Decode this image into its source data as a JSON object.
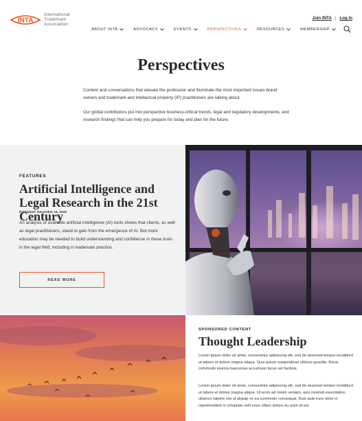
{
  "header": {
    "logo_text": [
      "International",
      "Trademark",
      "Association"
    ],
    "logo_abbr": "INTA",
    "join_link": "Join INTA",
    "separator": "|",
    "login_link": "Log In",
    "nav": [
      {
        "label": "ABOUT INTA",
        "active": false
      },
      {
        "label": "ADVOCACY",
        "active": false
      },
      {
        "label": "EVENTS",
        "active": false
      },
      {
        "label": "PERSPECTIVES",
        "active": true
      },
      {
        "label": "RESOURCES",
        "active": false
      },
      {
        "label": "MEMBERSHIP",
        "active": false
      }
    ],
    "accent_color": "#e8571d"
  },
  "intro": {
    "title": "Perspectives",
    "paragraph1": "Content and conversations that elevate the profession and illuminate the most important issues brand owners and trademark and intellectual property (IP) practitioners are talking about.",
    "paragraph2": "Our global contributors put into perspective business-critical trends, legal and regulatory developments, and research findings that can help you prepare for today and plan for the future."
  },
  "feature": {
    "eyebrow": "FEATURES",
    "title": "Artificial Intelligence and Legal Research in the 21st Century",
    "published": "Published: December 16, 2020",
    "description": "An analysis of available artificial intelligence (AI) tools shows that clients, as well as legal practitioners, stand to gain from the emergence of AI. But more education may be needed to build understanding and confidence in these tools in the legal field, including in trademark practice.",
    "button": "READ MORE"
  },
  "sponsored": {
    "eyebrow": "SPONSORED CONTENT",
    "title": "Thought Leadership",
    "paragraph1": "Lorem ipsum dolor sit amet, consectetur adipiscing elit, sed do eiusmod tempor incididunt ut labore et dolore magna aliqua. Quis ipsum suspendisse ultrices gravida. Risus commodo viverra maecenas accumsan lacus vel facilisis.",
    "paragraph2": "Lorem ipsum dolor sit amet, consectetur adipiscing elit, sed do eiusmod tempor incididunt ut labore et dolore magna aliqua. Ut enim ad minim veniam, quis nostrud exercitation ullamco laboris nisi ut aliquip ex ea commodo consequat. Duis aute irure dolor in reprehenderit in voluptate velit esse cillum dolore eu anim id est"
  }
}
